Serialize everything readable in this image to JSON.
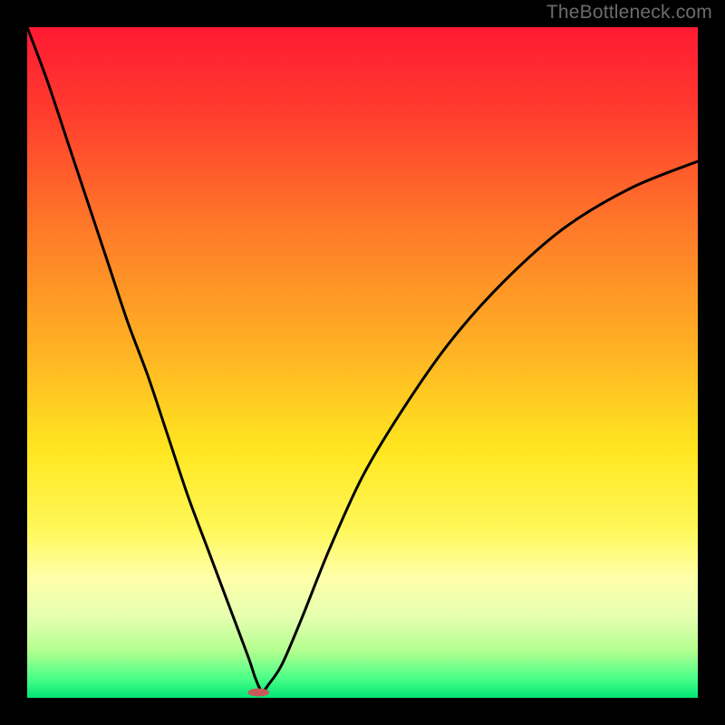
{
  "watermark": "TheBottleneck.com",
  "chart_data": {
    "type": "line",
    "title": "",
    "xlabel": "",
    "ylabel": "",
    "xlim": [
      0,
      100
    ],
    "ylim": [
      0,
      100
    ],
    "gradient_stops": [
      {
        "offset": 0.0,
        "color": "#ff1a33"
      },
      {
        "offset": 0.12,
        "color": "#ff3a2e"
      },
      {
        "offset": 0.3,
        "color": "#ff7a29"
      },
      {
        "offset": 0.48,
        "color": "#ffb224"
      },
      {
        "offset": 0.63,
        "color": "#ffe61f"
      },
      {
        "offset": 0.75,
        "color": "#fff85a"
      },
      {
        "offset": 0.82,
        "color": "#ffffa8"
      },
      {
        "offset": 0.88,
        "color": "#e5ffb0"
      },
      {
        "offset": 0.93,
        "color": "#b3ff90"
      },
      {
        "offset": 0.97,
        "color": "#4dff88"
      },
      {
        "offset": 1.0,
        "color": "#00e676"
      }
    ],
    "series": [
      {
        "name": "bottleneck-curve",
        "x": [
          0,
          3,
          6,
          9,
          12,
          15,
          18,
          21,
          24,
          27,
          30,
          33,
          34,
          35,
          36,
          38,
          41,
          45,
          50,
          56,
          63,
          71,
          80,
          90,
          100
        ],
        "y": [
          100,
          92,
          83,
          74,
          65,
          56,
          48,
          39,
          30,
          22,
          14,
          6,
          3,
          1,
          2,
          5,
          12,
          22,
          33,
          43,
          53,
          62,
          70,
          76,
          80
        ]
      }
    ],
    "optimum_marker": {
      "x": 34.5,
      "y": 0.8,
      "rx": 1.6,
      "ry": 0.6,
      "color": "#c65a5a"
    }
  }
}
